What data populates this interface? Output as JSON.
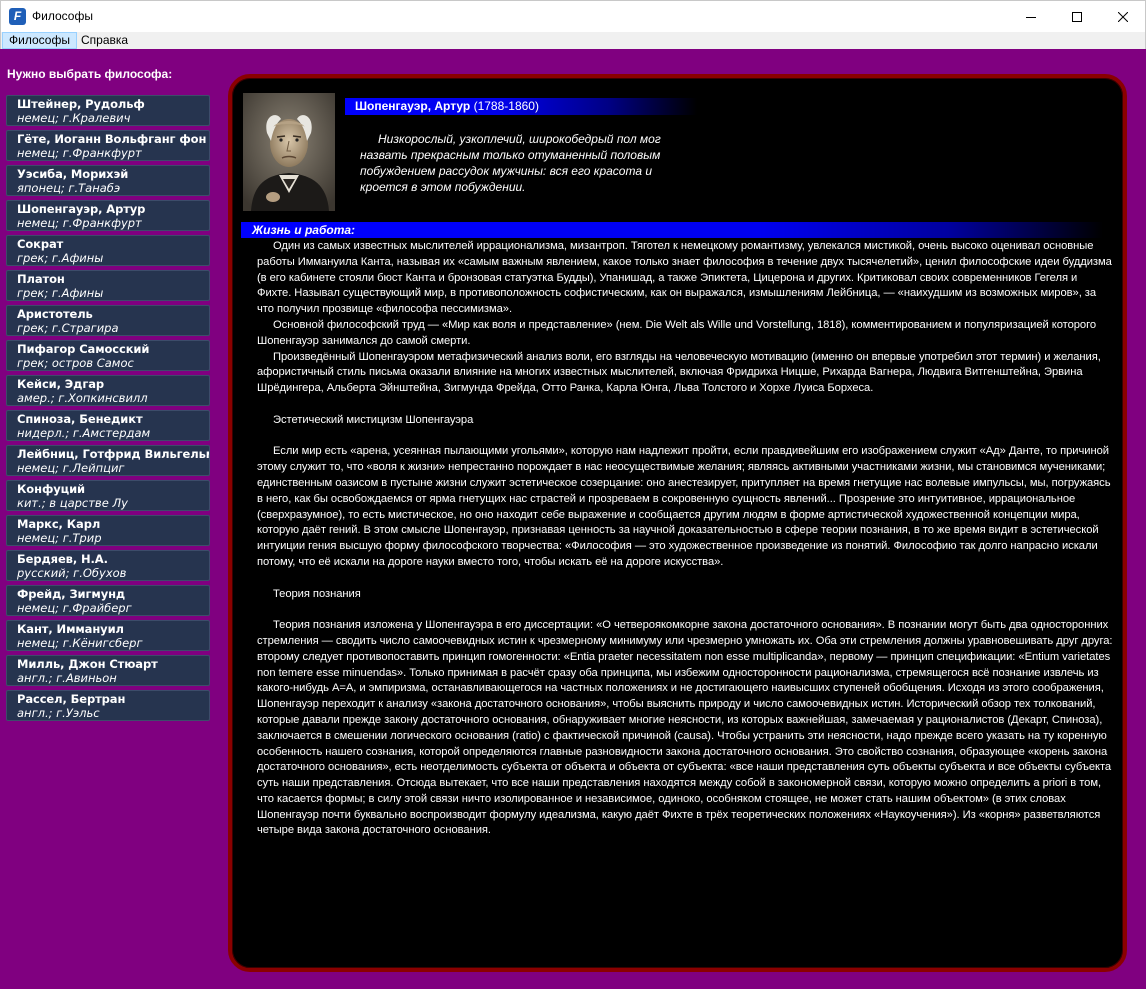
{
  "window": {
    "title": "Философы",
    "app_icon": "app-icon"
  },
  "menu": {
    "items": [
      "Философы",
      "Справка"
    ]
  },
  "sidebar": {
    "heading": "Нужно выбрать философа:",
    "philosophers": [
      {
        "name": "Штейнер, Рудольф",
        "origin": "немец; г.Кралевич"
      },
      {
        "name": "Гёте, Иоганн Вольфганг фон",
        "origin": "немец; г.Франкфурт"
      },
      {
        "name": "Уэсиба, Морихэй",
        "origin": "японец; г.Танабэ"
      },
      {
        "name": "Шопенгауэр, Артур",
        "origin": "немец; г.Франкфурт"
      },
      {
        "name": "Сократ",
        "origin": "грек; г.Афины"
      },
      {
        "name": "Платон",
        "origin": "грек; г.Афины"
      },
      {
        "name": "Аристотель",
        "origin": "грек; г.Страгира"
      },
      {
        "name": "Пифагор Самосский",
        "origin": "грек; остров Самос"
      },
      {
        "name": "Кейси, Эдгар",
        "origin": "амер.; г.Хопкинсвилл"
      },
      {
        "name": "Спиноза, Бенедикт",
        "origin": "нидерл.; г.Амстердам"
      },
      {
        "name": "Лейбниц, Готфрид Вильгельм",
        "origin": "немец; г.Лейпциг"
      },
      {
        "name": "Конфуций",
        "origin": "кит.; в царстве Лу"
      },
      {
        "name": "Маркс, Карл",
        "origin": "немец; г.Трир"
      },
      {
        "name": "Бердяев, Н.А.",
        "origin": "русский; г.Обухов"
      },
      {
        "name": "Фрейд, Зигмунд",
        "origin": "немец; г.Фрайберг"
      },
      {
        "name": "Кант, Иммануил",
        "origin": "немец; г.Кёнигсберг"
      },
      {
        "name": "Милль, Джон Стюарт",
        "origin": "англ.; г.Авиньон"
      },
      {
        "name": "Рассел, Бертран",
        "origin": "англ.; г.Уэльс"
      }
    ]
  },
  "detail": {
    "name": "Шопенгауэр, Артур",
    "years": "(1788-1860)",
    "quote": "Низкорослый, узкоплечий, широкобедрый пол мог назвать прекрасным только отуманенный половым побуждением рассудок мужчины: вся его красота и кроется в этом побуждении.",
    "life_heading": "Жизнь и работа:",
    "paragraphs": [
      "Один из самых известных мыслителей иррационализма, мизантроп. Тяготел к немецкому романтизму, увлекался мистикой, очень высоко оценивал основные работы Иммануила Канта, называя их «самым важным явлением, какое только знает философия в течение двух тысячелетий», ценил философские идеи буддизма (в его кабинете стояли бюст Канта и бронзовая статуэтка Будды), Упанишад, а также Эпиктета, Цицерона и других. Критиковал своих современников Гегеля и Фихте. Называл существующий мир, в противоположность софистическим, как он выражался, измышлениям Лейбница, — «наихудшим из возможных миров», за что получил прозвище «философа пессимизма».",
      "Основной философский труд — «Мир как воля и представление» (нем. Die Welt als Wille und Vorstellung, 1818), комментированием и популяризацией которого Шопенгауэр занимался до самой смерти.",
      "Произведённый Шопенгауэром метафизический анализ воли, его взгляды на человеческую мотивацию (именно он впервые употребил этот термин) и желания, афористичный стиль письма оказали влияние на многих известных мыслителей, включая Фридриха Ницше, Рихарда Вагнера, Людвига Витгенштейна, Эрвина Шрёдингера, Альберта Эйнштейна, Зигмунда Фрейда, Отто Ранка, Карла Юнга, Льва Толстого и Хорхе Луиса Борхеса.",
      "",
      "Эстетический мистицизм Шопенгауэра",
      "",
      "Если мир есть «арена, усеянная пылающими угольями», которую нам надлежит пройти, если правдивейшим его изображением служит «Ад» Данте, то причиной этому служит то, что «воля к жизни» непрестанно порождает в нас неосуществимые желания; являясь активными участниками жизни, мы становимся мучениками; единственным оазисом в пустыне жизни служит эстетическое созерцание: оно анестезирует, притупляет на время гнетущие нас волевые импульсы, мы, погружаясь в него, как бы освобождаемся от ярма гнетущих нас страстей и прозреваем в сокровенную сущность явлений... Прозрение это интуитивное, иррациональное (сверхразумное), то есть мистическое, но оно находит себе выражение и сообщается другим людям в форме артистической художественной концепции мира, которую даёт гений. В этом смысле Шопенгауэр, признавая ценность за научной доказательностью в сфере теории познания, в то же время видит в эстетической интуиции гения высшую форму философского творчества: «Философия — это художественное произведение из понятий. Философию так долго напрасно искали потому, что её искали на дороге науки вместо того, чтобы искать её на дороге искусства».",
      "",
      "Теория познания",
      "",
      "Теория познания изложена у Шопенгауэра в его диссертации: «О четвероякомкорне закона достаточного основания». В познании могут быть два односторонних стремления — сводить число самоочевидных истин к чрезмерному минимуму или чрезмерно умножать их. Оба эти стремления должны уравновешивать друг друга: второму следует противопоставить принцип гомогенности: «Entia praeter necessitatem non esse multiplicanda», первому — принцип спецификации: «Entium varietates non temere esse minuendas». Только принимая в расчёт сразу оба принципа, мы избежим односторонности рационализма, стремящегося всё познание извлечь из какого-нибудь A=A, и эмпиризма, останавливающегося на частных положениях и не достигающего наивысших ступеней обобщения. Исходя из этого соображения, Шопенгауэр переходит к анализу «закона достаточного основания», чтобы выяснить природу и число самоочевидных истин. Исторический обзор тех толкований, которые давали прежде закону достаточного основания, обнаруживает многие неясности, из которых важнейшая, замечаемая у рационалистов (Декарт, Спиноза), заключается в смешении логического основания (ratio) с фактической причиной (causa). Чтобы устранить эти неясности, надо прежде всего указать на ту коренную особенность нашего сознания, которой определяются главные разновидности закона достаточного основания. Это свойство сознания, образующее «корень закона достаточного основания», есть неотделимость субъекта от объекта и объекта от субъекта: «все наши представления суть объекты субъекта и все объекты субъекта суть наши представления. Отсюда вытекает, что все наши представления находятся между собой в закономерной связи, которую можно определить a priori в том, что касается формы; в силу этой связи ничто изолированное и независимое, одиноко, особняком стоящее, не может стать нашим объектом» (в этих словах Шопенгауэр почти буквально воспроизводит формулу идеализма, какую даёт Фихте в трёх теоретических положениях «Наукоучения»). Из «корня» разветвляются четыре вида закона достаточного основания."
    ]
  }
}
